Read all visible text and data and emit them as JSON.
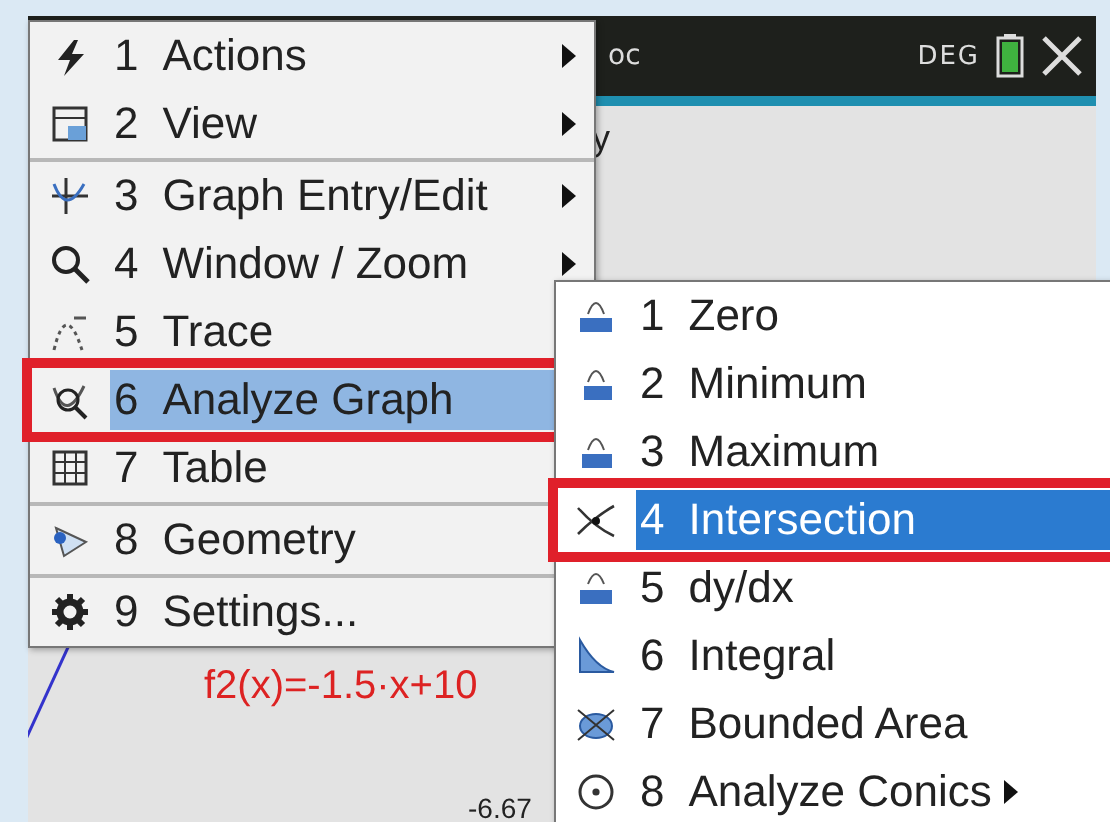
{
  "top_bar": {
    "document_title": "oc",
    "angle_mode": "DEG"
  },
  "graph": {
    "function_label": "f2(x)=-1.5·x+10",
    "axis_label": "-6.67",
    "hidden_label": "y"
  },
  "menu": {
    "items": [
      {
        "number": "1",
        "label": "Actions",
        "kind": "bolt",
        "submenu": true,
        "selected": false,
        "divider_after": false
      },
      {
        "number": "2",
        "label": "View",
        "kind": "window",
        "submenu": true,
        "selected": false,
        "divider_after": true
      },
      {
        "number": "3",
        "label": "Graph Entry/Edit",
        "kind": "entry",
        "submenu": true,
        "selected": false,
        "divider_after": false
      },
      {
        "number": "4",
        "label": "Window / Zoom",
        "kind": "search",
        "submenu": true,
        "selected": false,
        "divider_after": false
      },
      {
        "number": "5",
        "label": "Trace",
        "kind": "trace",
        "selected": false,
        "divider_after": false
      },
      {
        "number": "6",
        "label": "Analyze Graph",
        "kind": "analyze",
        "selected": true,
        "divider_after": false
      },
      {
        "number": "7",
        "label": "Table",
        "kind": "table",
        "selected": false,
        "divider_after": true
      },
      {
        "number": "8",
        "label": "Geometry",
        "kind": "geometry",
        "selected": false,
        "divider_after": true
      },
      {
        "number": "9",
        "label": "Settings...",
        "kind": "gear",
        "selected": false,
        "divider_after": false
      }
    ]
  },
  "submenu": {
    "items": [
      {
        "number": "1",
        "label": "Zero",
        "kind": "zero",
        "submenu": false,
        "selected": false
      },
      {
        "number": "2",
        "label": "Minimum",
        "kind": "min",
        "submenu": false,
        "selected": false
      },
      {
        "number": "3",
        "label": "Maximum",
        "kind": "max",
        "submenu": false,
        "selected": false
      },
      {
        "number": "4",
        "label": "Intersection",
        "kind": "intersection",
        "submenu": false,
        "selected": true
      },
      {
        "number": "5",
        "label": "dy/dx",
        "kind": "dydx",
        "submenu": false,
        "selected": false
      },
      {
        "number": "6",
        "label": "Integral",
        "kind": "integral",
        "submenu": false,
        "selected": false
      },
      {
        "number": "7",
        "label": "Bounded Area",
        "kind": "area",
        "submenu": false,
        "selected": false
      },
      {
        "number": "8",
        "label": "Analyze Conics",
        "kind": "conic",
        "submenu": true,
        "selected": false
      }
    ]
  }
}
